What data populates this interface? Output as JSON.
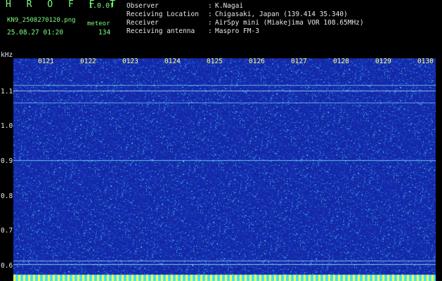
{
  "header": {
    "app_title": "H R O F F T",
    "version": "1.0.0f",
    "file_name": "KN9_2508270120.png",
    "meteor_label": "meteor",
    "datetime": "25.08.27 01:20",
    "meteor_count": "134"
  },
  "info": {
    "rows": [
      {
        "label": "Observer",
        "value": "K.Nagai"
      },
      {
        "label": "Receiving Location",
        "value": "Chigasaki, Japan (139.414 35.340)"
      },
      {
        "label": "Receiver",
        "value": "AirSpy mini (Miakejima VOR 108.65MHz)"
      },
      {
        "label": "Receiving antenna",
        "value": "Maspro FM-3"
      }
    ],
    "separator": ":"
  },
  "axes": {
    "y_unit": "kHz",
    "y_ticks": [
      "1.1",
      "1.0",
      "0.9",
      "0.8",
      "0.7",
      "0.6"
    ],
    "x_ticks": [
      "0121",
      "0122",
      "0123",
      "0124",
      "0125",
      "0126",
      "0127",
      "0128",
      "0129",
      "0130"
    ]
  },
  "colors": {
    "background": "#000000",
    "spectrogram_base": "#1a2a9c",
    "header_green": "#7dff7d",
    "tick_yellow": "#ffff80"
  }
}
